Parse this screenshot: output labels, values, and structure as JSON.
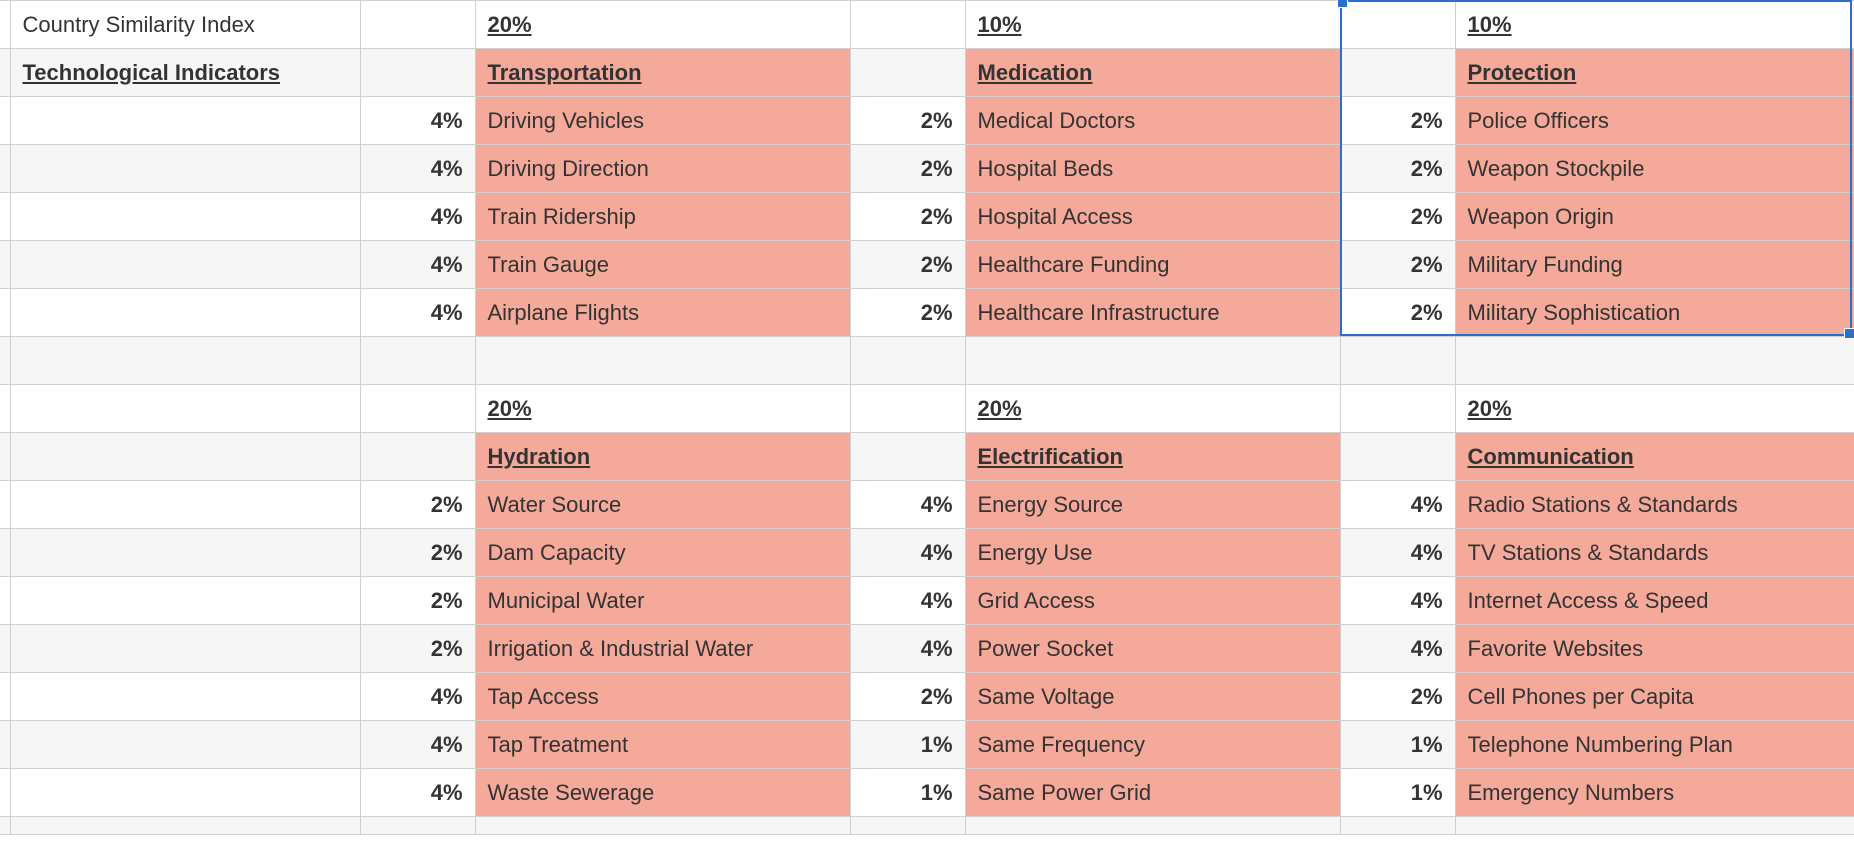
{
  "title_cell": "Country Similarity Index",
  "section_heading": "Technological Indicators",
  "groups_top": [
    {
      "weight": "20%",
      "name": "Transportation",
      "items": [
        {
          "pct": "4%",
          "label": "Driving Vehicles"
        },
        {
          "pct": "4%",
          "label": "Driving Direction"
        },
        {
          "pct": "4%",
          "label": "Train Ridership"
        },
        {
          "pct": "4%",
          "label": "Train Gauge"
        },
        {
          "pct": "4%",
          "label": "Airplane Flights"
        }
      ]
    },
    {
      "weight": "10%",
      "name": "Medication",
      "items": [
        {
          "pct": "2%",
          "label": "Medical Doctors"
        },
        {
          "pct": "2%",
          "label": "Hospital Beds"
        },
        {
          "pct": "2%",
          "label": "Hospital Access"
        },
        {
          "pct": "2%",
          "label": "Healthcare Funding"
        },
        {
          "pct": "2%",
          "label": "Healthcare Infrastructure"
        }
      ]
    },
    {
      "weight": "10%",
      "name": "Protection",
      "items": [
        {
          "pct": "2%",
          "label": "Police Officers"
        },
        {
          "pct": "2%",
          "label": "Weapon Stockpile"
        },
        {
          "pct": "2%",
          "label": "Weapon Origin"
        },
        {
          "pct": "2%",
          "label": "Military Funding"
        },
        {
          "pct": "2%",
          "label": "Military Sophistication"
        }
      ]
    }
  ],
  "groups_bottom": [
    {
      "weight": "20%",
      "name": "Hydration",
      "items": [
        {
          "pct": "2%",
          "label": "Water Source"
        },
        {
          "pct": "2%",
          "label": "Dam Capacity"
        },
        {
          "pct": "2%",
          "label": "Municipal Water"
        },
        {
          "pct": "2%",
          "label": "Irrigation & Industrial Water"
        },
        {
          "pct": "4%",
          "label": "Tap Access"
        },
        {
          "pct": "4%",
          "label": "Tap Treatment"
        },
        {
          "pct": "4%",
          "label": "Waste Sewerage"
        }
      ]
    },
    {
      "weight": "20%",
      "name": "Electrification",
      "items": [
        {
          "pct": "4%",
          "label": "Energy Source"
        },
        {
          "pct": "4%",
          "label": "Energy Use"
        },
        {
          "pct": "4%",
          "label": "Grid Access"
        },
        {
          "pct": "4%",
          "label": "Power Socket"
        },
        {
          "pct": "2%",
          "label": "Same Voltage"
        },
        {
          "pct": "1%",
          "label": "Same Frequency"
        },
        {
          "pct": "1%",
          "label": "Same Power Grid"
        }
      ]
    },
    {
      "weight": "20%",
      "name": "Communication",
      "items": [
        {
          "pct": "4%",
          "label": "Radio Stations & Standards"
        },
        {
          "pct": "4%",
          "label": "TV Stations & Standards"
        },
        {
          "pct": "4%",
          "label": "Internet Access & Speed"
        },
        {
          "pct": "4%",
          "label": "Favorite Websites"
        },
        {
          "pct": "2%",
          "label": "Cell Phones per Capita"
        },
        {
          "pct": "1%",
          "label": "Telephone Numbering Plan"
        },
        {
          "pct": "1%",
          "label": "Emergency Numbers"
        }
      ]
    }
  ]
}
